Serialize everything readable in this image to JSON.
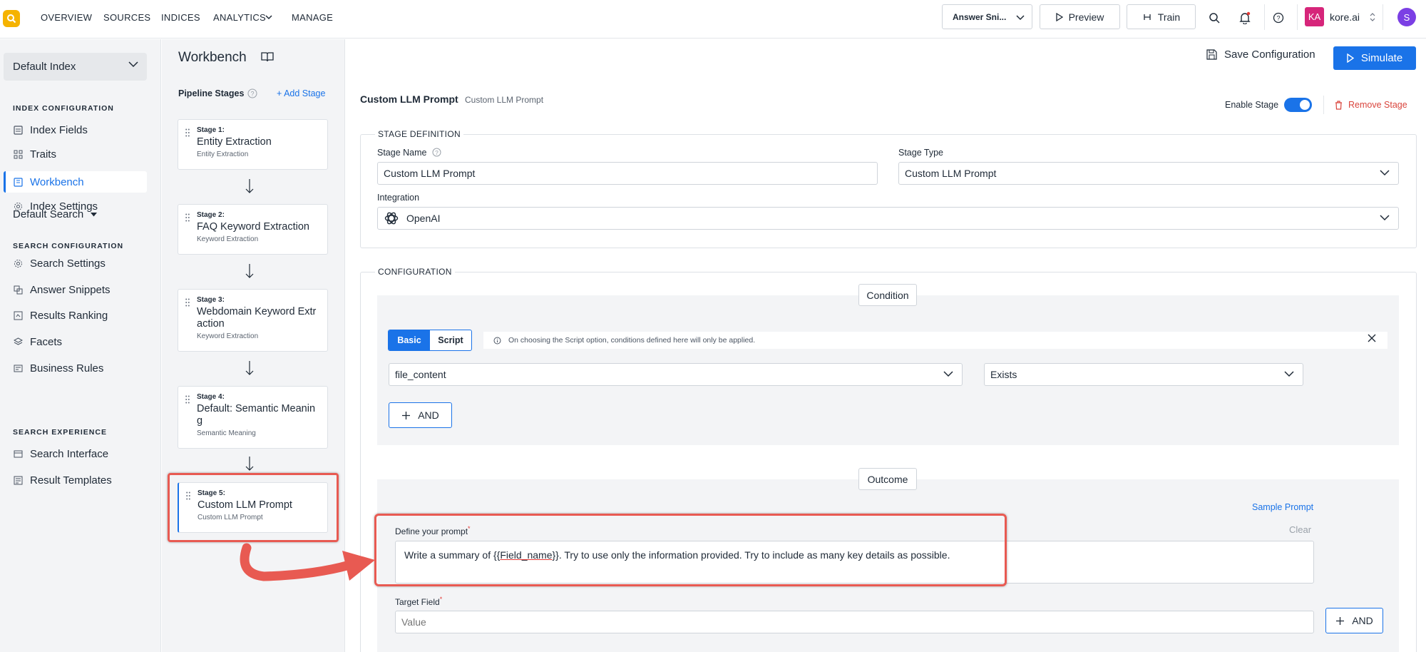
{
  "topnav": {
    "items": [
      "OVERVIEW",
      "SOURCES",
      "INDICES",
      "ANALYTICS",
      "MANAGE"
    ],
    "answer_snippets": "Answer Sni...",
    "preview": "Preview",
    "train": "Train",
    "account_initials": "KA",
    "account_name": "kore.ai",
    "user_initial": "S"
  },
  "sidebar": {
    "index_select": "Default Index",
    "index_config_title": "INDEX CONFIGURATION",
    "index_config_items": [
      "Index Fields",
      "Traits",
      "Workbench",
      "Index Settings"
    ],
    "search_config_title": "SEARCH CONFIGURATION",
    "default_search": "Default Search",
    "search_config_items": [
      "Search Settings",
      "Answer Snippets",
      "Results Ranking",
      "Facets",
      "Business Rules"
    ],
    "search_exp_title": "SEARCH EXPERIENCE",
    "search_exp_items": [
      "Search Interface",
      "Result Templates"
    ]
  },
  "workbench": {
    "title": "Workbench",
    "pipeline_title": "Pipeline Stages",
    "add_stage": "+ Add Stage",
    "stages": [
      {
        "num": "Stage 1:",
        "name": "Entity Extraction",
        "type": "Entity Extraction"
      },
      {
        "num": "Stage 2:",
        "name": "FAQ Keyword Extraction",
        "type": "Keyword Extraction"
      },
      {
        "num": "Stage 3:",
        "name": "Webdomain Keyword Extraction",
        "type": "Keyword Extraction"
      },
      {
        "num": "Stage 4:",
        "name": "Default: Semantic Meaning",
        "type": "Semantic Meaning"
      },
      {
        "num": "Stage 5:",
        "name": "Custom LLM Prompt",
        "type": "Custom LLM Prompt"
      }
    ]
  },
  "header": {
    "save_configuration": "Save Configuration",
    "simulate": "Simulate"
  },
  "detail": {
    "title": "Custom LLM Prompt",
    "subtitle": "Custom LLM Prompt",
    "enable_stage": "Enable Stage",
    "remove_stage": "Remove Stage",
    "stage_definition": "STAGE DEFINITION",
    "stage_name_label": "Stage Name",
    "stage_name_value": "Custom LLM Prompt",
    "stage_type_label": "Stage Type",
    "stage_type_value": "Custom LLM Prompt",
    "integration_label": "Integration",
    "integration_value": "OpenAI",
    "configuration": "CONFIGURATION",
    "condition": "Condition",
    "basic": "Basic",
    "script": "Script",
    "info": "On choosing the Script option, conditions defined here will only be applied.",
    "field_value": "file_content",
    "operator_value": "Exists",
    "and_label": "AND",
    "outcome": "Outcome",
    "sample_prompt": "Sample Prompt",
    "define_prompt_label": "Define your prompt",
    "clear": "Clear",
    "prompt_pre": "Write a summary of {{",
    "prompt_var": "Field_name",
    "prompt_post": "}}. Try to use only the information provided. Try to include as many key details as possible.",
    "target_field_label": "Target Field",
    "target_field_placeholder": "Value"
  },
  "colors": {
    "accent": "#1a73e8",
    "highlight": "#e85a52",
    "logo": "#f5b301"
  }
}
